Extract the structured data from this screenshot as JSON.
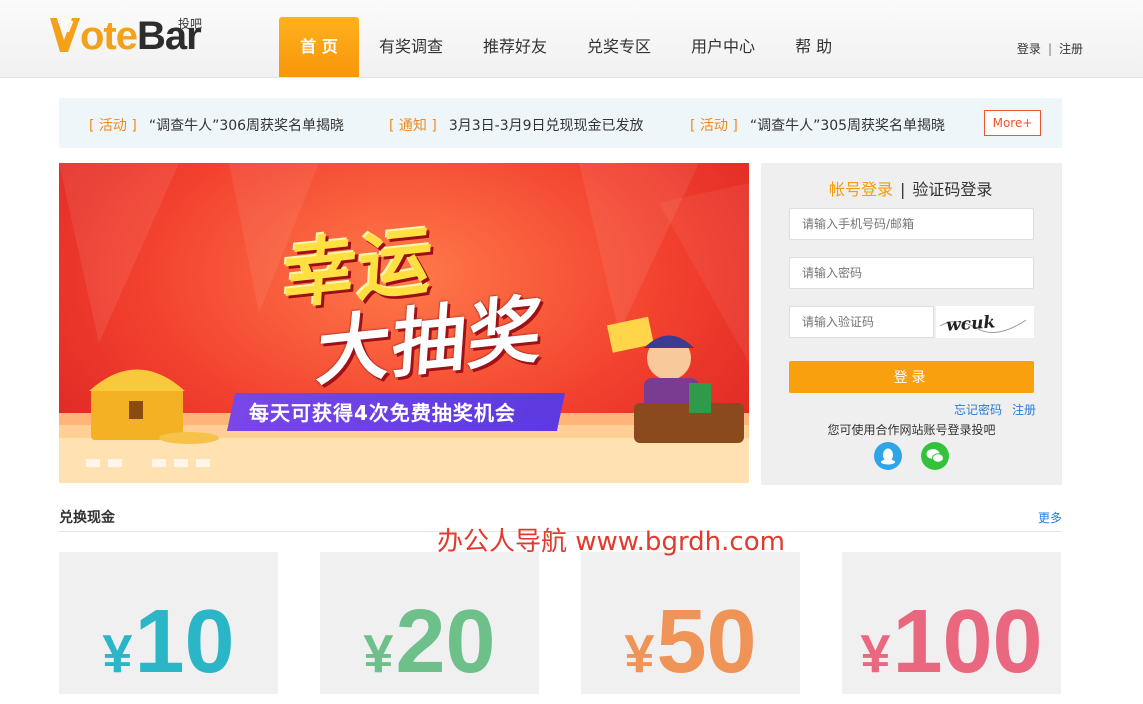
{
  "header": {
    "logo_prefix": "V",
    "logo_main": "ote",
    "logo_bar": "Bar",
    "logo_sub": "投吧",
    "nav": [
      "首 页",
      "有奖调查",
      "推荐好友",
      "兑奖专区",
      "用户中心",
      "帮 助"
    ],
    "active_nav": 0,
    "login_link": "登录",
    "link_sep": "|",
    "register_link": "注册"
  },
  "notice": {
    "items": [
      {
        "tag": "[ 活动 ]",
        "text": "“调查牛人”306周获奖名单揭晓"
      },
      {
        "tag": "[ 通知 ]",
        "text": "3月3日-3月9日兑现现金已发放"
      },
      {
        "tag": "[ 活动 ]",
        "text": "“调查牛人”305周获奖名单揭晓"
      }
    ],
    "more": "More+"
  },
  "banner": {
    "title_line1": "幸运",
    "title_line2": "大抽奖",
    "subtitle": "每天可获得4次免费抽奖机会",
    "slide_count": 5
  },
  "login": {
    "tab_account": "帐号登录",
    "tab_sep": "|",
    "tab_code": "验证码登录",
    "phone_placeholder": "请输入手机号码/邮箱",
    "password_placeholder": "请输入密码",
    "captcha_placeholder": "请输入验证码",
    "captcha_text": "wcuk",
    "submit": "登录",
    "forgot": "忘记密码",
    "register": "注册",
    "third_party_text": "您可使用合作网站账号登录投吧",
    "social": [
      {
        "name": "qq-icon",
        "color": "#2fa4e7"
      },
      {
        "name": "wechat-icon",
        "color": "#33c23a"
      }
    ]
  },
  "cash": {
    "title": "兑换现金",
    "more": "更多",
    "watermark": "办公人导航 www.bgrdh.com",
    "cards": [
      {
        "currency": "¥",
        "amount": "10",
        "color": "#2bb6c8"
      },
      {
        "currency": "¥",
        "amount": "20",
        "color": "#6ec08a"
      },
      {
        "currency": "¥",
        "amount": "50",
        "color": "#ef9357"
      },
      {
        "currency": "¥",
        "amount": "100",
        "color": "#ea6780"
      }
    ]
  }
}
